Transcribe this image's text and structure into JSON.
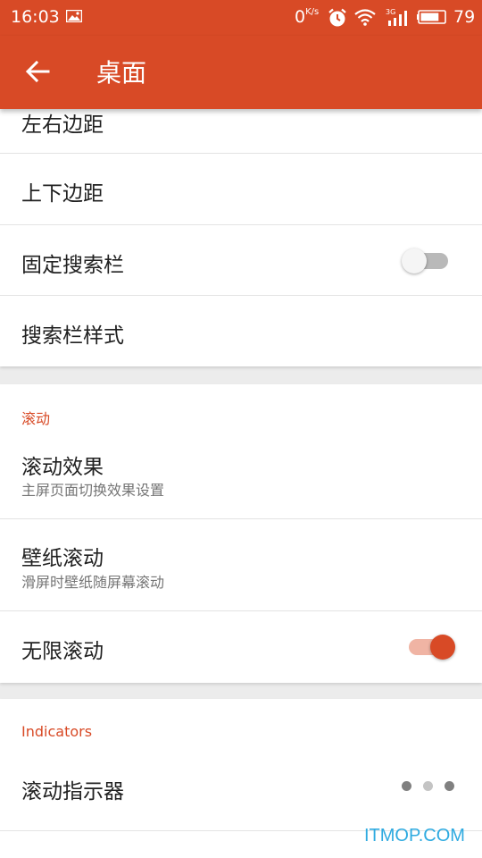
{
  "status_bar": {
    "time": "16:03",
    "net_speed_value": "0",
    "net_speed_unit": "K/s",
    "network_type": "3G",
    "battery_level": "79",
    "icons": [
      "image-icon",
      "alarm-icon",
      "wifi-icon",
      "signal-icon",
      "battery-icon"
    ]
  },
  "app_bar": {
    "title": "桌面",
    "back_icon": "arrow-left-icon"
  },
  "group_layout": {
    "items": [
      {
        "label": "左右边距"
      },
      {
        "label": "上下边距"
      },
      {
        "label": "固定搜索栏",
        "toggle": false
      },
      {
        "label": "搜索栏样式"
      }
    ]
  },
  "group_scroll": {
    "title": "滚动",
    "items": [
      {
        "label": "滚动效果",
        "subtitle": "主屏页面切换效果设置"
      },
      {
        "label": "壁纸滚动",
        "subtitle": "滑屏时壁纸随屏幕滚动"
      },
      {
        "label": "无限滚动",
        "toggle": true
      }
    ]
  },
  "group_indicators": {
    "title": "Indicators",
    "items": [
      {
        "label": "滚动指示器"
      }
    ]
  },
  "watermark": "ITMOP.COM",
  "colors": {
    "accent": "#d84a26",
    "accent_light": "#f0b4a4",
    "background": "#ececec",
    "divider": "#e3e3e3",
    "primary_text": "#212121",
    "secondary_text": "#757575",
    "watermark": "#2eaae0"
  }
}
